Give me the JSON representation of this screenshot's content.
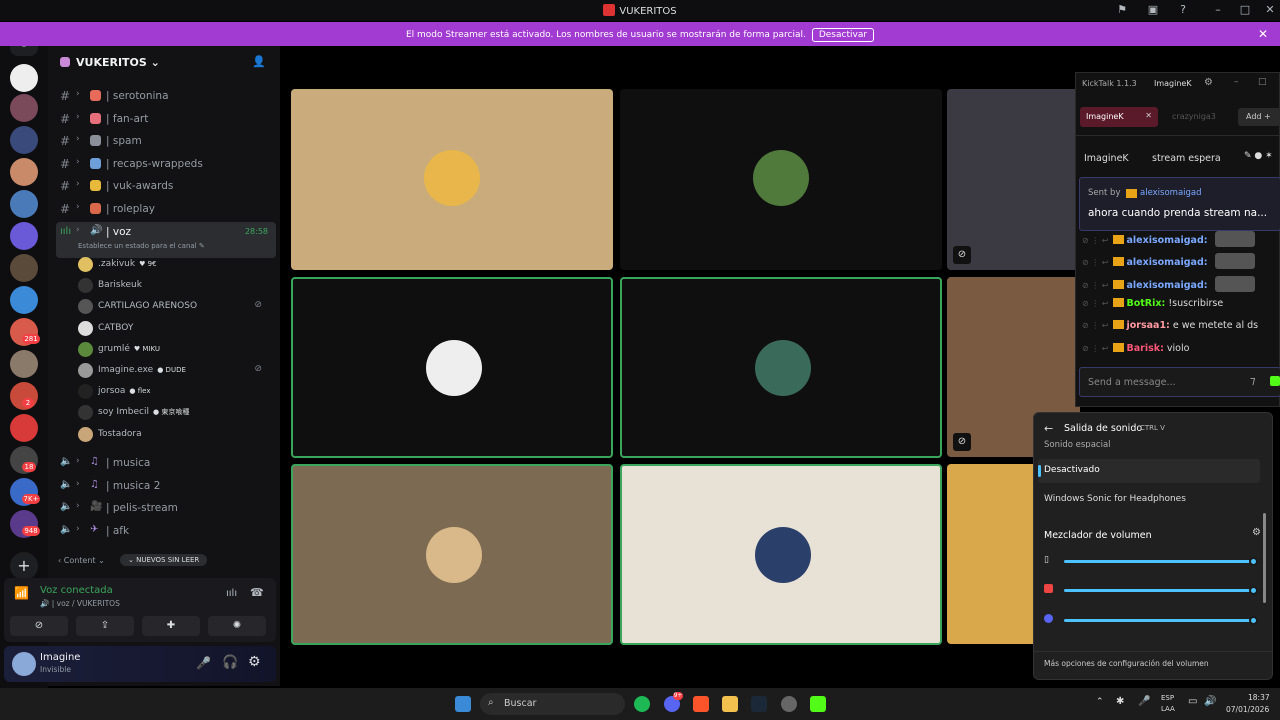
{
  "window": {
    "title": "VUKERITOS"
  },
  "banner": {
    "message": "El modo Streamer está activado. Los nombres de usuario se mostrarán de forma parcial.",
    "button": "Desactivar"
  },
  "rail": {
    "badges": [
      "281",
      "2",
      "18",
      "7K+",
      "948"
    ]
  },
  "server": {
    "name": "VUKERITOS ⌄"
  },
  "channels": [
    {
      "name": "| serotonina",
      "color": "#e86a5a"
    },
    {
      "name": "| fan-art",
      "color": "#e76f7c"
    },
    {
      "name": "| spam",
      "color": "#8a8f99"
    },
    {
      "name": "| recaps-wrappeds",
      "color": "#6f9fd8"
    },
    {
      "name": "| vuk-awards",
      "color": "#e8b93a"
    },
    {
      "name": "| roleplay",
      "color": "#d9694a"
    }
  ],
  "voice_channel": {
    "name": "| voz",
    "timer": "28:58",
    "status": "Establece un estado para el canal ✎"
  },
  "members": [
    {
      "name": ".zakivuk",
      "tag": "♥ 9€",
      "color": "#e0c060",
      "muted": false
    },
    {
      "name": "Bariskeuk",
      "tag": "",
      "color": "#333",
      "muted": false
    },
    {
      "name": "CARTILAGO ARENOSO",
      "tag": "",
      "color": "#555",
      "muted": true
    },
    {
      "name": "CATBOY",
      "tag": "",
      "color": "#ddd",
      "muted": false
    },
    {
      "name": "grumlé",
      "tag": "♥ MIKU",
      "color": "#5b8a3c",
      "muted": false
    },
    {
      "name": "Imagine.exe",
      "tag": "● DUDE",
      "color": "#999",
      "muted": true
    },
    {
      "name": "jorsoa",
      "tag": "● flex",
      "color": "#222",
      "muted": false
    },
    {
      "name": "soy Imbecil",
      "tag": "● 東京喰種",
      "color": "#333",
      "muted": false
    },
    {
      "name": "Tostadora",
      "tag": "",
      "color": "#c9a57a",
      "muted": false
    }
  ],
  "other_voice": [
    {
      "name": "| musica",
      "icon": "♫"
    },
    {
      "name": "| musica 2",
      "icon": "♫"
    },
    {
      "name": "| pelis-stream",
      "icon": "🎥"
    },
    {
      "name": "| afk",
      "icon": "✈"
    }
  ],
  "content_label": "‹ Content ⌄",
  "unread_button": "⌄ NUEVOS SIN LEER",
  "voice_panel": {
    "status": "Voz conectada",
    "sub": "🔊 | voz / VUKERITOS"
  },
  "user": {
    "name": "Imagine",
    "status": "Invisible"
  },
  "tiles": [
    {
      "bg": "#c9ab7c",
      "border": "none",
      "avatar": "#e8b64a",
      "muted": false
    },
    {
      "bg": "#0f0f0f",
      "border": "none",
      "avatar": "#4f7a3c",
      "muted": false
    },
    {
      "bg": "#0f0f0f",
      "border": "#3ba55c",
      "avatar": "#eee",
      "muted": false
    },
    {
      "bg": "#0f0f0f",
      "border": "#3ba55c",
      "avatar": "#3a6a5a",
      "muted": false
    },
    {
      "bg": "#7d6a52",
      "border": "#3ba55c",
      "avatar": "#d9b98a",
      "muted": false
    },
    {
      "bg": "#e8e2d6",
      "border": "#3ba55c",
      "avatar": "#2a3f6a",
      "muted": false
    }
  ],
  "kicktalk": {
    "title": "KickTalk 1.1.3",
    "header_user": "ImagineK",
    "tabs": [
      "ImagineK",
      "crazyniga3"
    ],
    "add": "Add +",
    "channel": "ImagineK",
    "stream_title": "stream espera",
    "sent_by": "Sent by",
    "sender": "alexisomaigad",
    "pinned": "ahora cuando prenda stream na...",
    "messages": [
      {
        "user": "alexisomaigad:",
        "text": "",
        "color": "#7aa8ff",
        "pill": true
      },
      {
        "user": "alexisomaigad:",
        "text": "",
        "color": "#7aa8ff",
        "pill": true
      },
      {
        "user": "alexisomaigad:",
        "text": "",
        "color": "#7aa8ff",
        "pill": true
      },
      {
        "user": "BotRix:",
        "text": "!suscribirse",
        "color": "#53fc18",
        "pill": false
      },
      {
        "user": "jorsaa1:",
        "text": "e we metete al ds",
        "color": "#ff9aa2",
        "pill": false
      },
      {
        "user": "Barisk:",
        "text": "violo",
        "color": "#ff5577",
        "pill": false
      }
    ],
    "input_placeholder": "Send a message..."
  },
  "sound": {
    "title": "Salida de sonido",
    "shortcut": "CTRL  V",
    "cut": "Sonido espacial",
    "opt1": "Desactivado",
    "opt2": "Windows Sonic for Headphones",
    "mixer": "Mezclador de volumen",
    "more": "Más opciones de configuración del volumen"
  },
  "taskbar": {
    "search": "Buscar",
    "lang1": "ESP",
    "lang2": "LAA",
    "time": "18:37",
    "date": "07/01/2026",
    "discord_badge": "9+"
  }
}
